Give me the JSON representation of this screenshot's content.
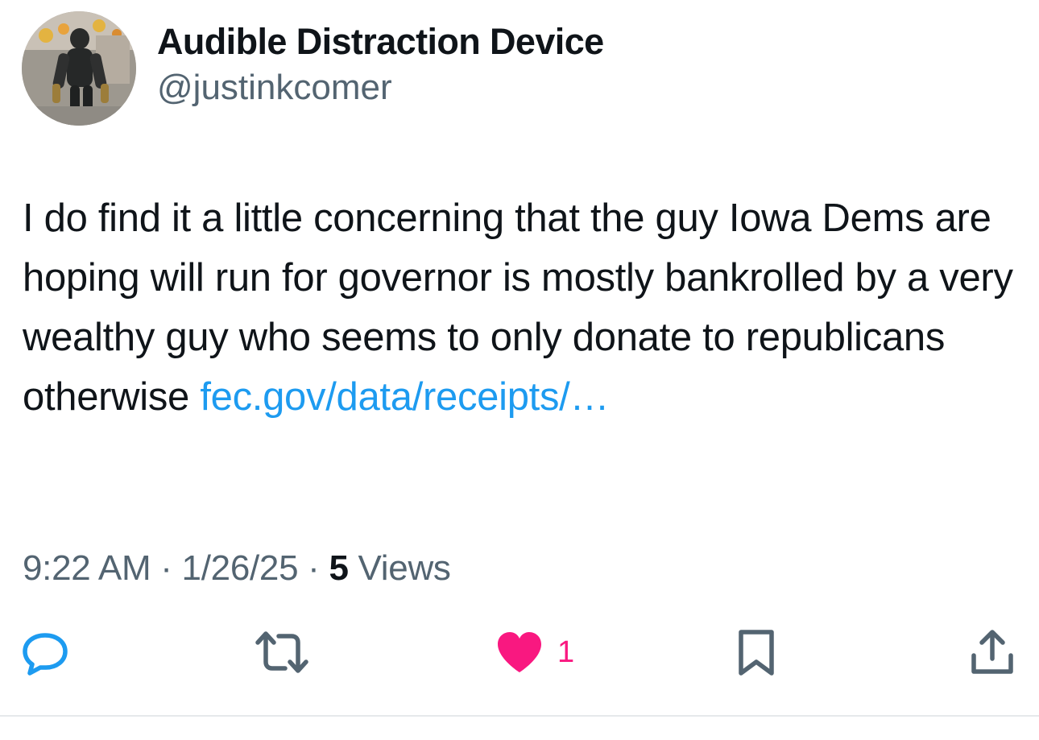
{
  "author": {
    "display_name": "Audible Distraction Device",
    "handle": "@justinkcomer",
    "avatar_icon": "profile-photo"
  },
  "tweet": {
    "text": "I do find it a little concerning that the guy Iowa Dems are hoping will run for governor is mostly bankrolled by a very wealthy guy who seems to only donate to republicans otherwise ",
    "link_text": "fec.gov/data/receipts/…"
  },
  "meta": {
    "time": "9:22 AM",
    "separator": " · ",
    "date": "1/26/25",
    "views_count": "5",
    "views_label": " Views"
  },
  "actions": {
    "reply_icon": "speech-bubble-icon",
    "retweet_icon": "retweet-arrows-icon",
    "like_icon": "heart-icon",
    "like_count": "1",
    "bookmark_icon": "bookmark-icon",
    "share_icon": "share-upload-icon"
  },
  "colors": {
    "text": "#0f1419",
    "secondary": "#536471",
    "link": "#1d9bf0",
    "like": "#f91880"
  }
}
